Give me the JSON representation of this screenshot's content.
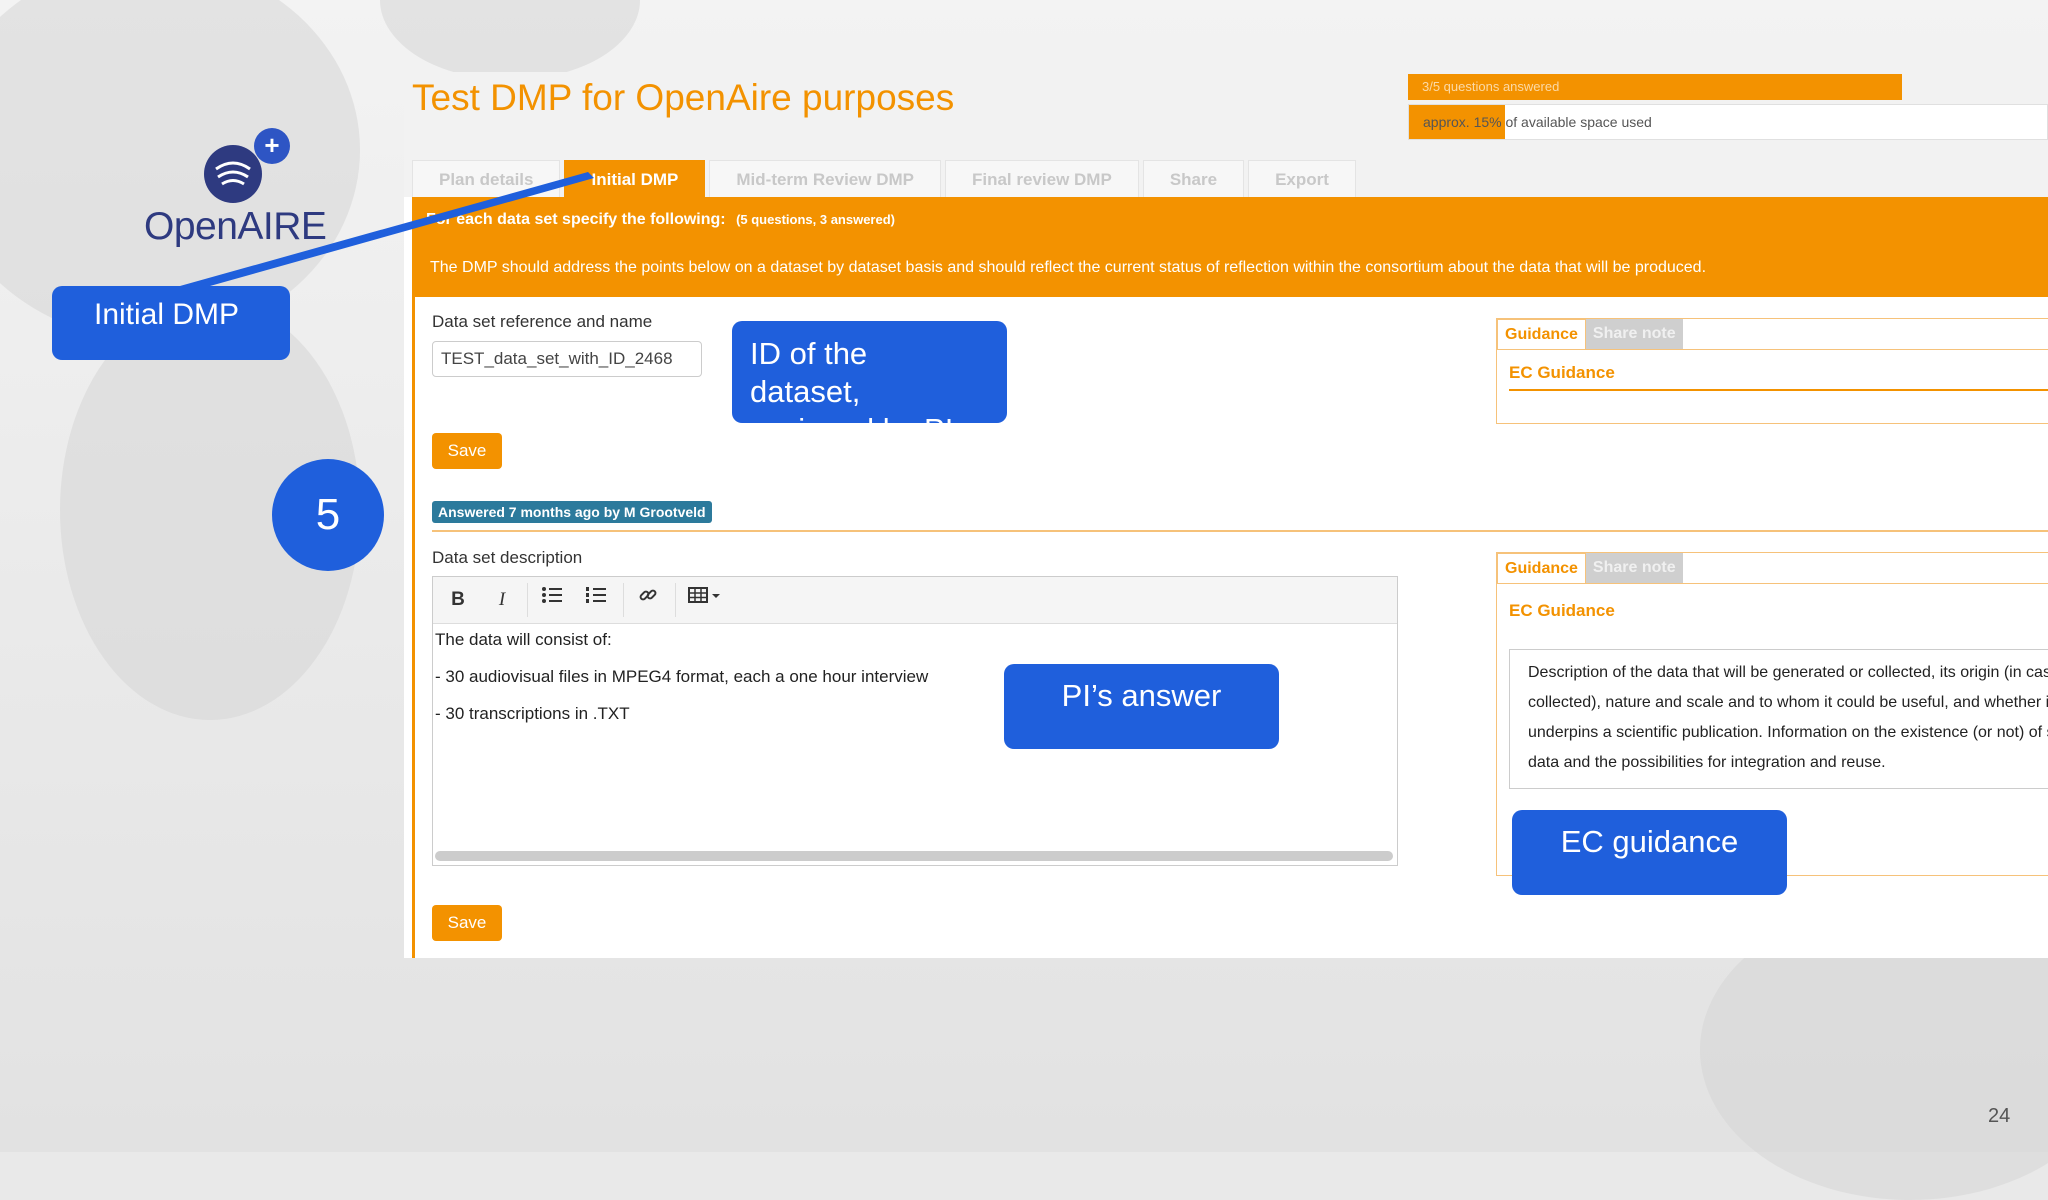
{
  "logo": {
    "text": "OpenAIRE",
    "plus": "+"
  },
  "callouts": {
    "initial_dmp": "Initial DMP",
    "step_number": "5",
    "id_dataset_line1": "ID of the",
    "id_dataset_line2": "dataset,",
    "id_dataset_line3": "assigned by PI",
    "pi_answer": "PI’s answer",
    "ec_guidance": "EC guidance"
  },
  "plan": {
    "title": "Test DMP for OpenAire purposes",
    "questions_answered": "3/5 questions answered",
    "space_used": "approx. 15% of available space used",
    "space_used_fraction": 0.15
  },
  "tabs": [
    {
      "label": "Plan details",
      "active": false
    },
    {
      "label": "Initial DMP",
      "active": true
    },
    {
      "label": "Mid-term Review DMP",
      "active": false
    },
    {
      "label": "Final review DMP",
      "active": false
    },
    {
      "label": "Share",
      "active": false
    },
    {
      "label": "Export",
      "active": false
    }
  ],
  "section": {
    "heading": "For each data set specify the following:",
    "heading_meta": "(5 questions, 3 answered)",
    "description": "The DMP should address the points below on a dataset by dataset basis and should reflect the current status of reflection within the consortium about the data that will be produced."
  },
  "q1": {
    "label": "Data set reference and name",
    "value": "TEST_data_set_with_ID_2468",
    "save": "Save",
    "guidance_tab": "Guidance",
    "share_note_tab": "Share note",
    "ec_guidance": "EC Guidance"
  },
  "q2": {
    "answered_badge": "Answered 7 months ago by M Grootveld",
    "label": "Data set description",
    "answer_lines": [
      "The data will consist of:",
      "- 30 audiovisual files in MPEG4 format, each a one hour interview",
      "- 30 transcriptions in .TXT"
    ],
    "save": "Save",
    "guidance_tab": "Guidance",
    "share_note_tab": "Share note",
    "ec_guidance": "EC Guidance",
    "guidance_lines": [
      "Description of the data that will be generated or collected, its origin (in case it is",
      "collected), nature and scale and to whom it could be useful, and whether it",
      "underpins a scientific publication. Information on the existence (or not) of similar",
      "data and the possibilities for integration and reuse."
    ]
  },
  "toolbar": {
    "bold": "B",
    "italic": "I"
  },
  "page_number": "24"
}
